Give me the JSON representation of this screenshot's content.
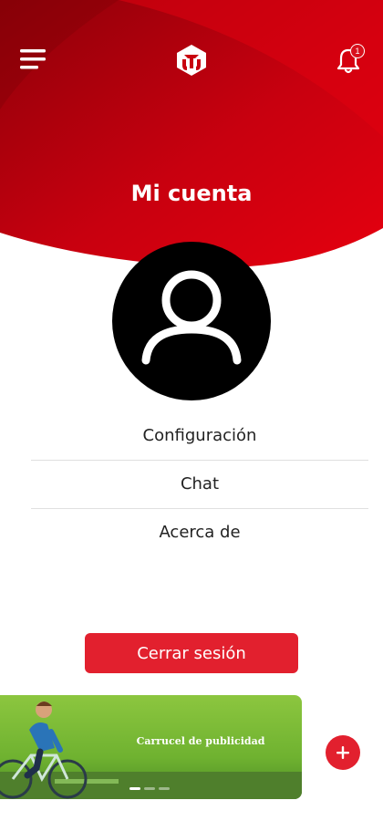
{
  "header": {
    "title": "Mi cuenta",
    "menu_icon": "hamburger-menu-icon",
    "logo_icon": "brand-logo-icon",
    "notification_icon": "bell-icon",
    "notification_count": "1"
  },
  "profile": {
    "avatar_icon": "user-avatar-icon"
  },
  "menu": {
    "items": [
      {
        "label": "Configuración"
      },
      {
        "label": "Chat"
      },
      {
        "label": "Acerca de"
      }
    ]
  },
  "actions": {
    "logout_label": "Cerrar sesión",
    "fab_icon": "plus-icon"
  },
  "banner": {
    "text": "Carrucel de publicidad",
    "slide_count": 3,
    "active_slide": 1
  },
  "colors": {
    "primary": "#e2202e",
    "header_dark": "#8e0009",
    "banner_green": "#8cc63f",
    "avatar_bg": "#000000"
  }
}
